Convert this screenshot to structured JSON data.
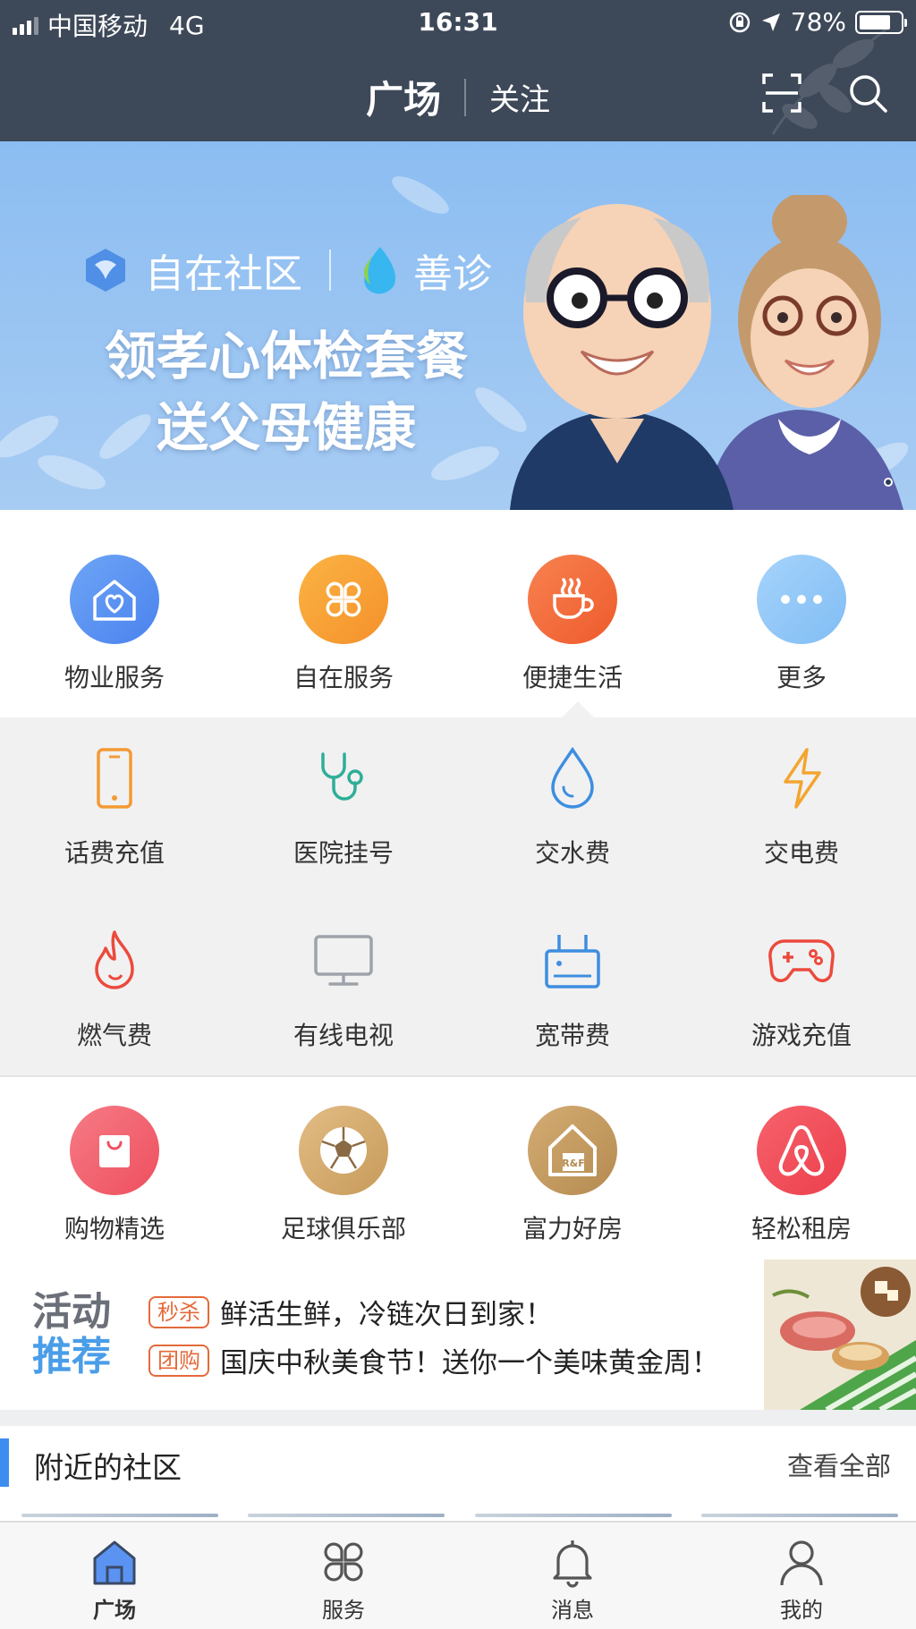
{
  "status_bar": {
    "carrier": "中国移动",
    "network": "4G",
    "time": "16:31",
    "battery": "78%",
    "battery_level": 0.78
  },
  "nav": {
    "active_tab": "广场",
    "tab": "关注",
    "icons": [
      "scan-icon",
      "search-icon"
    ]
  },
  "banner": {
    "brand1": "自在社区",
    "brand2": "善诊",
    "title_line1": "领孝心体检套餐",
    "title_line2": "送父母健康"
  },
  "categories": [
    {
      "label": "物业服务",
      "icon": "house-heart-icon",
      "color": "#5b93f2"
    },
    {
      "label": "自在服务",
      "icon": "clover-grid-icon",
      "color": "#f7a12e"
    },
    {
      "label": "便捷生活",
      "icon": "coffee-cup-icon",
      "color": "#f36a3c"
    },
    {
      "label": "更多",
      "icon": "more-dots-icon",
      "color": "#8fc5f6"
    }
  ],
  "services_row1": [
    {
      "label": "话费充值",
      "icon": "phone-icon"
    },
    {
      "label": "医院挂号",
      "icon": "stethoscope-icon"
    },
    {
      "label": "交水费",
      "icon": "water-drop-icon"
    },
    {
      "label": "交电费",
      "icon": "lightning-icon"
    }
  ],
  "services_row2": [
    {
      "label": "燃气费",
      "icon": "flame-icon"
    },
    {
      "label": "有线电视",
      "icon": "tv-icon"
    },
    {
      "label": "宽带费",
      "icon": "router-icon"
    },
    {
      "label": "游戏充值",
      "icon": "gamepad-icon"
    }
  ],
  "partners": [
    {
      "label": "购物精选",
      "icon": "shopping-bag-icon"
    },
    {
      "label": "足球俱乐部",
      "icon": "football-icon"
    },
    {
      "label": "富力好房",
      "icon": "house-rf-icon",
      "badge": "R&F"
    },
    {
      "label": "轻松租房",
      "icon": "airbnb-icon"
    }
  ],
  "activity": {
    "title_line1": "活动",
    "title_line2": "推荐",
    "items": [
      {
        "tag": "秒杀",
        "text": "鲜活生鲜，冷链次日到家！"
      },
      {
        "tag": "团购",
        "text": "国庆中秋美食节！送你一个美味黄金周！"
      }
    ]
  },
  "nearby": {
    "title": "附近的社区",
    "view_all": "查看全部"
  },
  "tabbar": [
    {
      "label": "广场",
      "icon": "home-icon",
      "active": true
    },
    {
      "label": "服务",
      "icon": "services-grid-icon",
      "active": false
    },
    {
      "label": "消息",
      "icon": "bell-icon",
      "active": false
    },
    {
      "label": "我的",
      "icon": "profile-icon",
      "active": false
    }
  ]
}
